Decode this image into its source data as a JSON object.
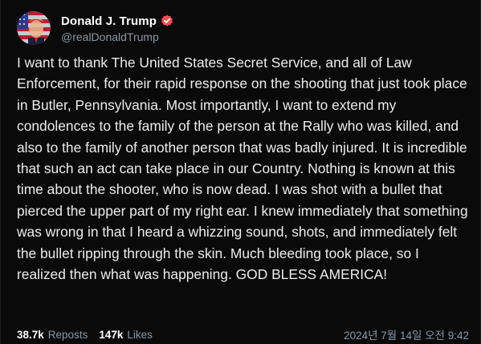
{
  "post": {
    "author": {
      "display_name": "Donald J. Trump",
      "handle": "@realDonaldTrump",
      "verified": true,
      "badge_color": "#ff4f4f"
    },
    "body": "I want to thank The United States Secret Service, and all of Law Enforcement, for their rapid response on the shooting that just took place in Butler, Pennsylvania. Most importantly, I want to extend my condolences to the family of the person at the Rally who was killed, and also to the family of another person that was badly injured. It is incredible that such an act can take place in our Country. Nothing is known at this time about the shooter, who is now dead. I was shot with a bullet that pierced the upper part of my right ear. I knew immediately that something was wrong in that I heard a whizzing sound, shots, and immediately felt the bullet ripping through the skin. Much bleeding took place, so I realized then what was happening. GOD BLESS AMERICA!",
    "stats": {
      "reposts_count": "38.7k",
      "reposts_label": "Reposts",
      "likes_count": "147k",
      "likes_label": "Likes"
    },
    "timestamp": "2024년 7월 14일 오전 9:42"
  },
  "icons": {
    "avatar": "profile-avatar",
    "badge": "verified-badge-icon"
  },
  "colors": {
    "background": "#0a0a0a",
    "text_primary": "#ececec",
    "text_secondary": "#8b98a5"
  }
}
